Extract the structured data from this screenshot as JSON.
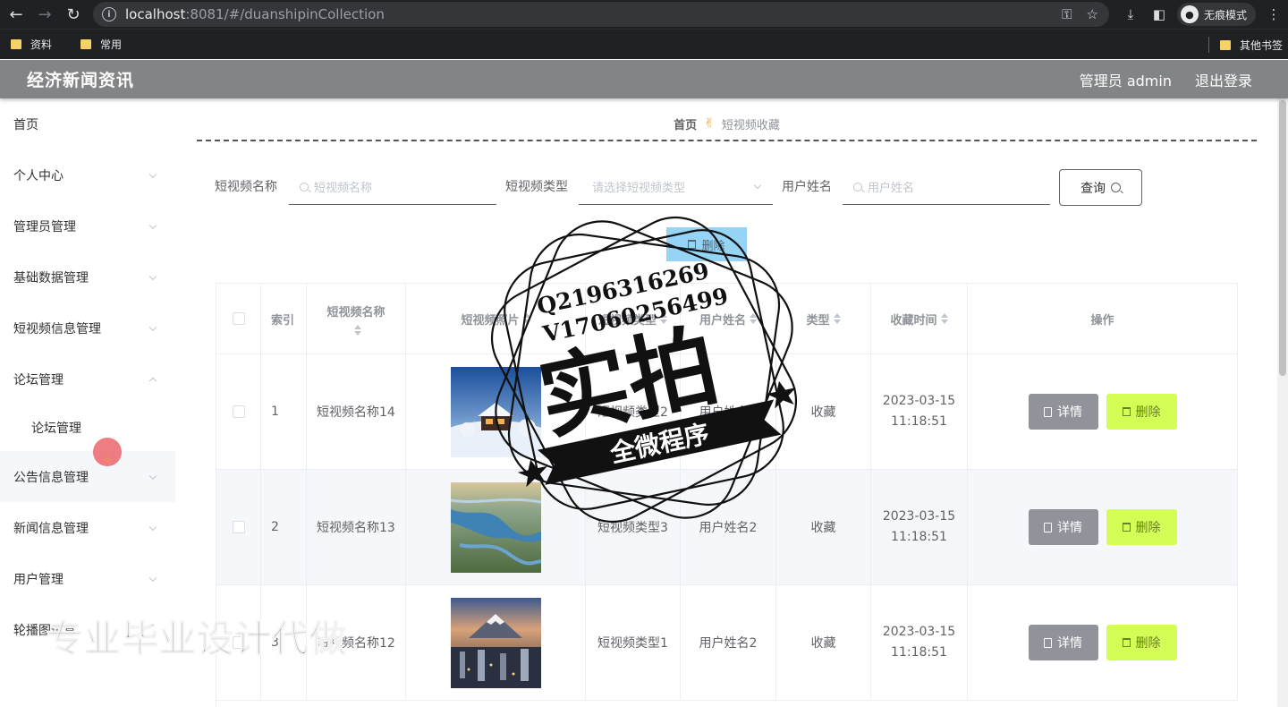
{
  "browser": {
    "url_host": "localhost",
    "url_rest": ":8081/#/duanshipinCollection",
    "incognito_label": "无痕模式",
    "bookmarks": [
      "资料",
      "常用"
    ],
    "other_bookmarks": "其他书签"
  },
  "header": {
    "title": "经济新闻资讯",
    "user_label": "管理员 admin",
    "logout_label": "退出登录"
  },
  "sidebar": {
    "items": [
      {
        "label": "首页"
      },
      {
        "label": "个人中心"
      },
      {
        "label": "管理员管理"
      },
      {
        "label": "基础数据管理"
      },
      {
        "label": "短视频信息管理"
      },
      {
        "label": "论坛管理"
      },
      {
        "label": "论坛管理"
      },
      {
        "label": "公告信息管理"
      },
      {
        "label": "新闻信息管理"
      },
      {
        "label": "用户管理"
      },
      {
        "label": "轮播图信息"
      }
    ]
  },
  "breadcrumb": {
    "home": "首页",
    "current": "短视频收藏"
  },
  "search": {
    "name_label": "短视频名称",
    "name_placeholder": "短视频名称",
    "type_label": "短视频类型",
    "type_placeholder": "请选择短视频类型",
    "user_label": "用户姓名",
    "user_placeholder": "用户姓名",
    "query_label": "查询"
  },
  "toolbar": {
    "delete_label": "删除"
  },
  "table": {
    "columns": [
      "索引",
      "短视频名称",
      "短视频照片",
      "短视频类型",
      "用户姓名",
      "类型",
      "收藏时间",
      "操作"
    ],
    "rows": [
      {
        "index": "1",
        "name": "短视频名称14",
        "video_type": "短视频类型2",
        "user": "用户姓名2",
        "kind": "收藏",
        "date": "2023-03-15",
        "time": "11:18:51"
      },
      {
        "index": "2",
        "name": "短视频名称13",
        "video_type": "短视频类型3",
        "user": "用户姓名2",
        "kind": "收藏",
        "date": "2023-03-15",
        "time": "11:18:51"
      },
      {
        "index": "3",
        "name": "短视频名称12",
        "video_type": "短视频类型1",
        "user": "用户姓名2",
        "kind": "收藏",
        "date": "2023-03-15",
        "time": "11:18:51"
      }
    ],
    "detail_label": "详情",
    "delete_label": "删除"
  },
  "overlay": {
    "stamp_line1": "Q2196316269",
    "stamp_line2": "V17060256499",
    "stamp_main": "实拍",
    "stamp_banner": "全微程序",
    "watermark": "专业毕业设计代做"
  }
}
